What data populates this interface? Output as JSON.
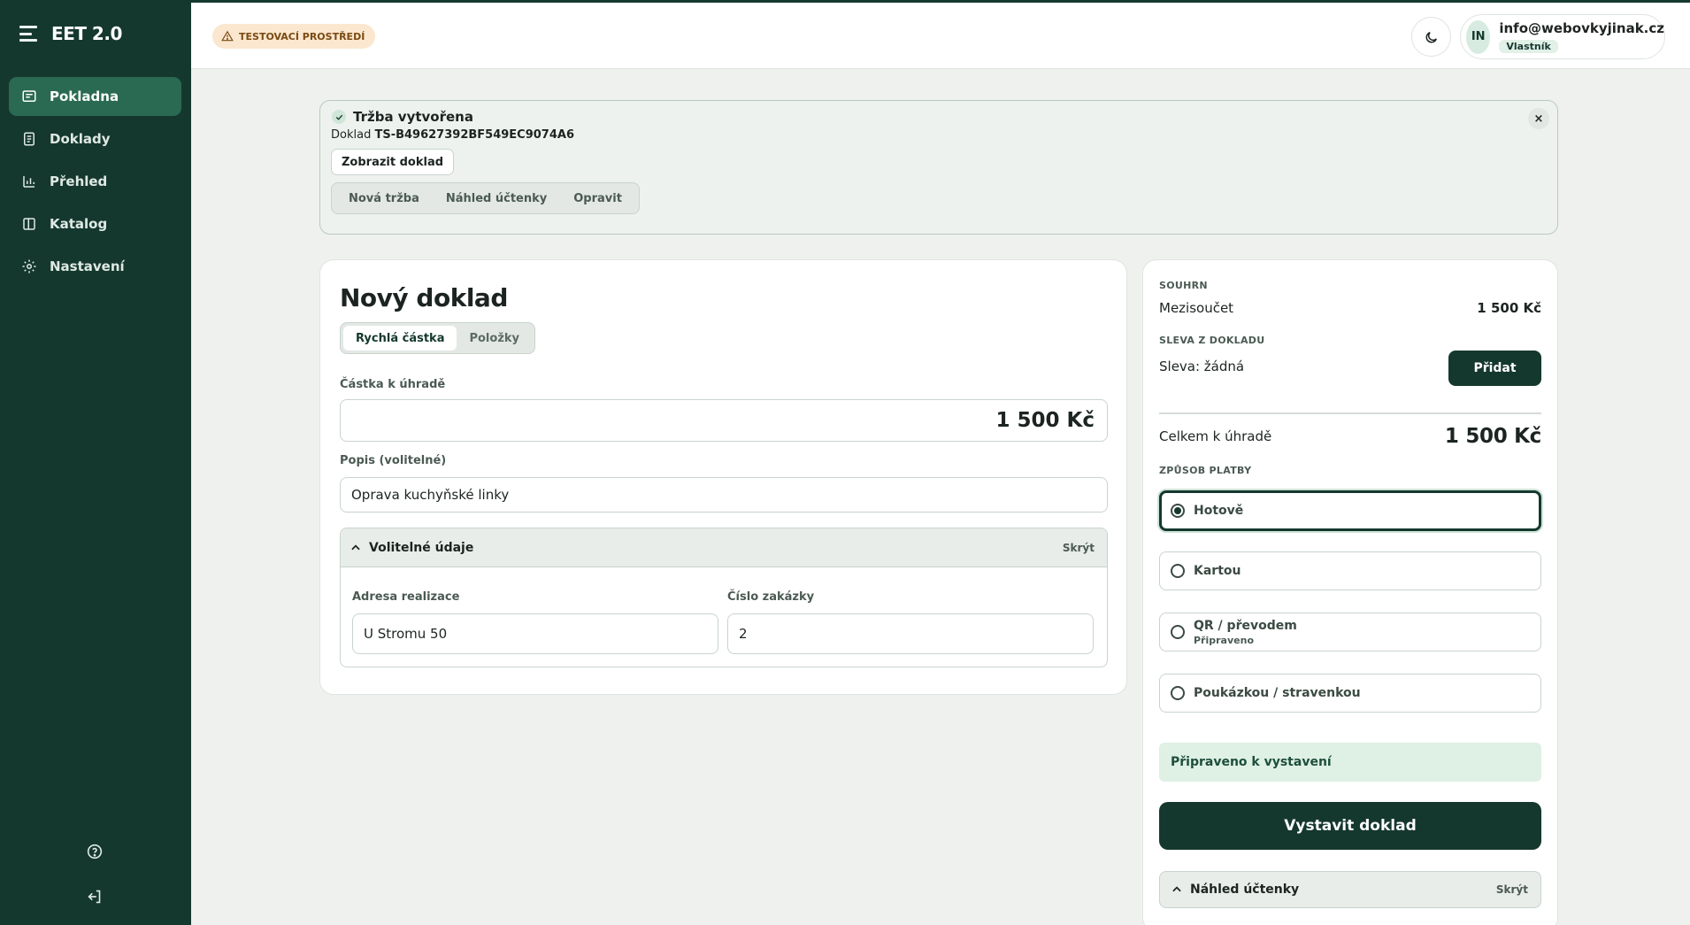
{
  "app": {
    "brand": "EET 2.0"
  },
  "sidebar": {
    "items": [
      {
        "label": "Pokladna",
        "icon": "receipt-icon"
      },
      {
        "label": "Doklady",
        "icon": "document-icon"
      },
      {
        "label": "Přehled",
        "icon": "bar-chart-icon"
      },
      {
        "label": "Katalog",
        "icon": "book-icon"
      },
      {
        "label": "Nastavení",
        "icon": "gear-icon"
      }
    ]
  },
  "header": {
    "env_badge": "TESTOVACÍ PROSTŘEDÍ",
    "user_email": "info@webovkyjinak.cz",
    "user_role": "Vlastník",
    "avatar_initials": "IN"
  },
  "notice": {
    "title": "Tržba vytvořena",
    "doc_prefix": "Doklad",
    "doc_id": "TS-B49627392BF549EC9074A6",
    "show_button": "Zobrazit doklad",
    "actions": [
      "Nová tržba",
      "Náhled účtenky",
      "Opravit"
    ],
    "close": "×"
  },
  "form": {
    "title": "Nový doklad",
    "tabs": [
      "Rychlá částka",
      "Položky"
    ],
    "amount_label": "Částka k úhradě",
    "amount_value": "1 500 Kč",
    "desc_label": "Popis (volitelné)",
    "desc_value": "Oprava kuchyňské linky",
    "optional_title": "Volitelné údaje",
    "optional_hide": "Skrýt",
    "address_label": "Adresa realizace",
    "address_value": "U Stromu 50",
    "order_label": "Číslo zakázky",
    "order_value": "2"
  },
  "summary": {
    "section_title": "SOUHRN",
    "subtotal_label": "Mezisoučet",
    "subtotal_value": "1 500 Kč",
    "discount_title": "SLEVA Z DOKLADU",
    "discount_value": "Sleva: žádná",
    "add_button": "Přidat",
    "total_label": "Celkem k úhradě",
    "total_value": "1 500 Kč",
    "payment_title": "ZPŮSOB PLATBY",
    "payment_options": [
      {
        "label": "Hotově",
        "sub": "",
        "selected": true
      },
      {
        "label": "Kartou",
        "sub": "",
        "selected": false
      },
      {
        "label": "QR / převodem",
        "sub": "Připraveno",
        "selected": false
      },
      {
        "label": "Poukázkou / stravenkou",
        "sub": "",
        "selected": false
      }
    ],
    "ready_text": "Připraveno k vystavení",
    "issue_button": "Vystavit doklad",
    "preview_title": "Náhled účtenky",
    "preview_hide": "Skrýt"
  },
  "colors": {
    "brand_dark": "#15382e",
    "accent_active": "#2a6a53",
    "warning_bg": "#fbe7cf",
    "success_bg": "#dff0e5"
  }
}
